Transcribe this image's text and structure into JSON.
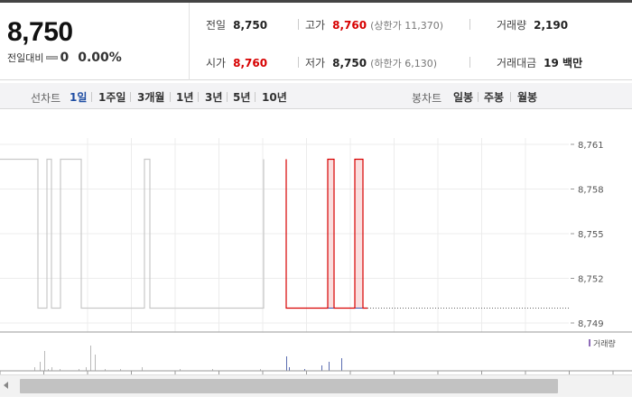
{
  "summary": {
    "price": "8,750",
    "change_label": "전일대비",
    "change_value": "0",
    "change_pct": "0.00%"
  },
  "stats": {
    "prev_close_label": "전일",
    "prev_close": "8,750",
    "high_label": "고가",
    "high": "8,760",
    "upper_limit": "(상한가 11,370)",
    "volume_label": "거래량",
    "volume": "2,190",
    "open_label": "시가",
    "open": "8,760",
    "low_label": "저가",
    "low": "8,750",
    "lower_limit": "(하한가 6,130)",
    "amount_label": "거래대금",
    "amount": "19 백만"
  },
  "periods": {
    "line_label": "선차트",
    "line_items": [
      "1일",
      "1주일",
      "3개월",
      "1년",
      "3년",
      "5년",
      "10년"
    ],
    "active": "1일",
    "candle_label": "봉차트",
    "candle_items": [
      "일봉",
      "주봉",
      "월봉"
    ]
  },
  "chart_data": {
    "type": "line",
    "y_ticks": [
      "8,761",
      "8,758",
      "8,755",
      "8,752",
      "8,749"
    ],
    "ylim": [
      8749,
      8761
    ],
    "volume_legend": "거래량",
    "grid": true,
    "segments": [
      {
        "color": "#c8c8c8",
        "points": [
          [
            0,
            8760
          ],
          [
            42,
            8760
          ],
          [
            42,
            8750
          ],
          [
            52,
            8750
          ],
          [
            52,
            8760
          ],
          [
            57,
            8760
          ],
          [
            57,
            8750
          ],
          [
            67,
            8750
          ],
          [
            67,
            8760
          ],
          [
            90,
            8760
          ],
          [
            90,
            8750
          ],
          [
            160,
            8750
          ],
          [
            160,
            8760
          ],
          [
            166,
            8760
          ],
          [
            166,
            8750
          ],
          [
            292,
            8750
          ],
          [
            292,
            8760
          ]
        ]
      },
      {
        "color": "#d70000",
        "points": [
          [
            317,
            8760
          ],
          [
            317,
            8750
          ],
          [
            363,
            8750
          ],
          [
            363,
            8760
          ],
          [
            370,
            8760
          ],
          [
            370,
            8750
          ],
          [
            393,
            8750
          ],
          [
            393,
            8760
          ],
          [
            402,
            8760
          ],
          [
            402,
            8750
          ],
          [
            407,
            8750
          ]
        ]
      }
    ],
    "volume_bars": [
      {
        "x": 38,
        "v": 2
      },
      {
        "x": 44,
        "v": 5
      },
      {
        "x": 49,
        "v": 11
      },
      {
        "x": 53,
        "v": 1
      },
      {
        "x": 57,
        "v": 2
      },
      {
        "x": 66,
        "v": 1
      },
      {
        "x": 87,
        "v": 1
      },
      {
        "x": 95,
        "v": 2
      },
      {
        "x": 100,
        "v": 14
      },
      {
        "x": 105,
        "v": 9
      },
      {
        "x": 116,
        "v": 1
      },
      {
        "x": 133,
        "v": 1
      },
      {
        "x": 157,
        "v": 2
      },
      {
        "x": 199,
        "v": 1
      },
      {
        "x": 235,
        "v": 1
      },
      {
        "x": 288,
        "v": 1
      },
      {
        "x": 317,
        "v": 8
      },
      {
        "x": 320,
        "v": 2
      },
      {
        "x": 337,
        "v": 1
      },
      {
        "x": 356,
        "v": 3
      },
      {
        "x": 364,
        "v": 5
      },
      {
        "x": 378,
        "v": 7
      }
    ]
  }
}
